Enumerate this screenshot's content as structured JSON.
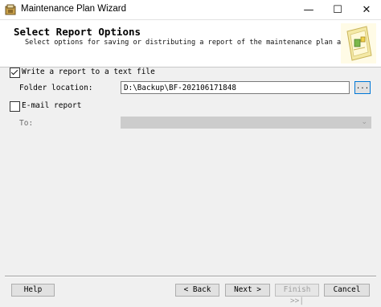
{
  "window": {
    "title": "Maintenance Plan Wizard",
    "minimize_glyph": "—",
    "maximize_glyph": "☐",
    "close_glyph": "✕"
  },
  "header": {
    "title": "Select Report Options",
    "subtitle": "Select options for saving or distributing a report of the maintenance plan actions."
  },
  "text_report": {
    "checkbox_label": "Write a report to a text file",
    "checked": true,
    "folder_label": "Folder location:",
    "folder_value": "D:\\Backup\\BF-202106171848",
    "browse_label": "..."
  },
  "email_report": {
    "checkbox_label": "E-mail report",
    "checked": false,
    "to_label": "To:",
    "to_value": ""
  },
  "footer": {
    "help": "Help",
    "back": "< Back",
    "next": "Next >",
    "finish": "Finish >>|",
    "cancel": "Cancel"
  },
  "colors": {
    "accent": "#0078d7",
    "disabled_text": "#a0a0a0"
  }
}
